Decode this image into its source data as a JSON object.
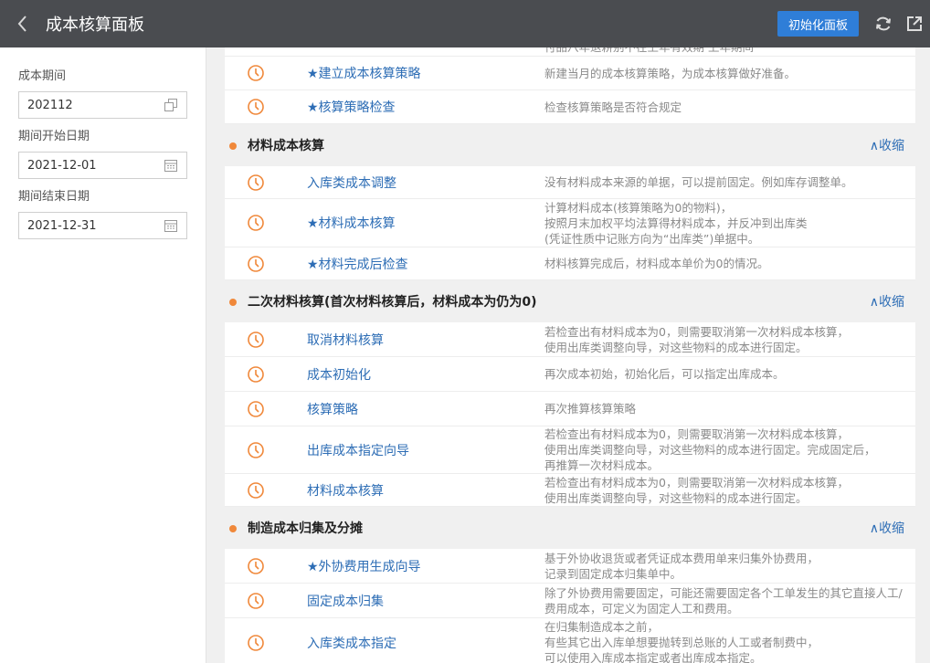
{
  "header": {
    "title": "成本核算面板",
    "init_button": "初始化面板",
    "icons": [
      "back-icon",
      "refresh-icon",
      "share-icon"
    ]
  },
  "sidebar": {
    "period_label": "成本期间",
    "period_value": "202112",
    "start_label": "期间开始日期",
    "start_value": "2021-12-01",
    "end_label": "期间结束日期",
    "end_value": "2021-12-31"
  },
  "top_rows": {
    "partial_desc": "付品八年退耕别不在上年有效期 上年期间",
    "items": [
      {
        "name": "★建立成本核算策略",
        "desc": "新建当月的成本核算策略，为成本核算做好准备。"
      },
      {
        "name": "★核算策略检查",
        "desc": "检查核算策略是否符合规定"
      }
    ]
  },
  "sections": [
    {
      "title": "材料成本核算",
      "collapse": "∧收缩",
      "items": [
        {
          "name": "入库类成本调整",
          "desc": "没有材料成本来源的单据，可以提前固定。例如库存调整单。"
        },
        {
          "name": "★材料成本核算",
          "desc": "计算材料成本(核算策略为0的物料)，\n按照月末加权平均法算得材料成本，并反冲到出库类\n(凭证性质中记账方向为“出库类”)单据中。"
        },
        {
          "name": "★材料完成后检查",
          "desc": "材料核算完成后，材料成本单价为0的情况。"
        }
      ]
    },
    {
      "title": "二次材料核算(首次材料核算后，材料成本为仍为0)",
      "collapse": "∧收缩",
      "items": [
        {
          "name": "取消材料核算",
          "desc": "若检查出有材料成本为0，则需要取消第一次材料成本核算，\n使用出库类调整向导，对这些物料的成本进行固定。"
        },
        {
          "name": "成本初始化",
          "desc": "再次成本初始，初始化后，可以指定出库成本。"
        },
        {
          "name": "核算策略",
          "desc": "再次推算核算策略"
        },
        {
          "name": "出库成本指定向导",
          "desc": "若检查出有材料成本为0，则需要取消第一次材料成本核算，\n使用出库类调整向导，对这些物料的成本进行固定。完成固定后，\n再推算一次材料成本。"
        },
        {
          "name": "材料成本核算",
          "desc": "若检查出有材料成本为0，则需要取消第一次材料成本核算，\n使用出库类调整向导，对这些物料的成本进行固定。"
        }
      ]
    },
    {
      "title": "制造成本归集及分摊",
      "collapse": "∧收缩",
      "items": [
        {
          "name": "★外协费用生成向导",
          "desc": "基于外协收退货或者凭证成本费用单来归集外协费用，\n记录到固定成本归集单中。"
        },
        {
          "name": "固定成本归集",
          "desc": "除了外协费用需要固定，可能还需要固定各个工单发生的其它直接人工/\n费用成本，可定义为固定人工和费用。"
        },
        {
          "name": "入库类成本指定",
          "desc": "在归集制造成本之前，\n有些其它出入库单想要抛转到总账的人工或者制费中，\n可以使用入库成本指定或者出库成本指定。"
        }
      ]
    }
  ],
  "colors": {
    "accent": "#2f7ed8",
    "link": "#2d6db5",
    "orange": "#f0883a"
  }
}
